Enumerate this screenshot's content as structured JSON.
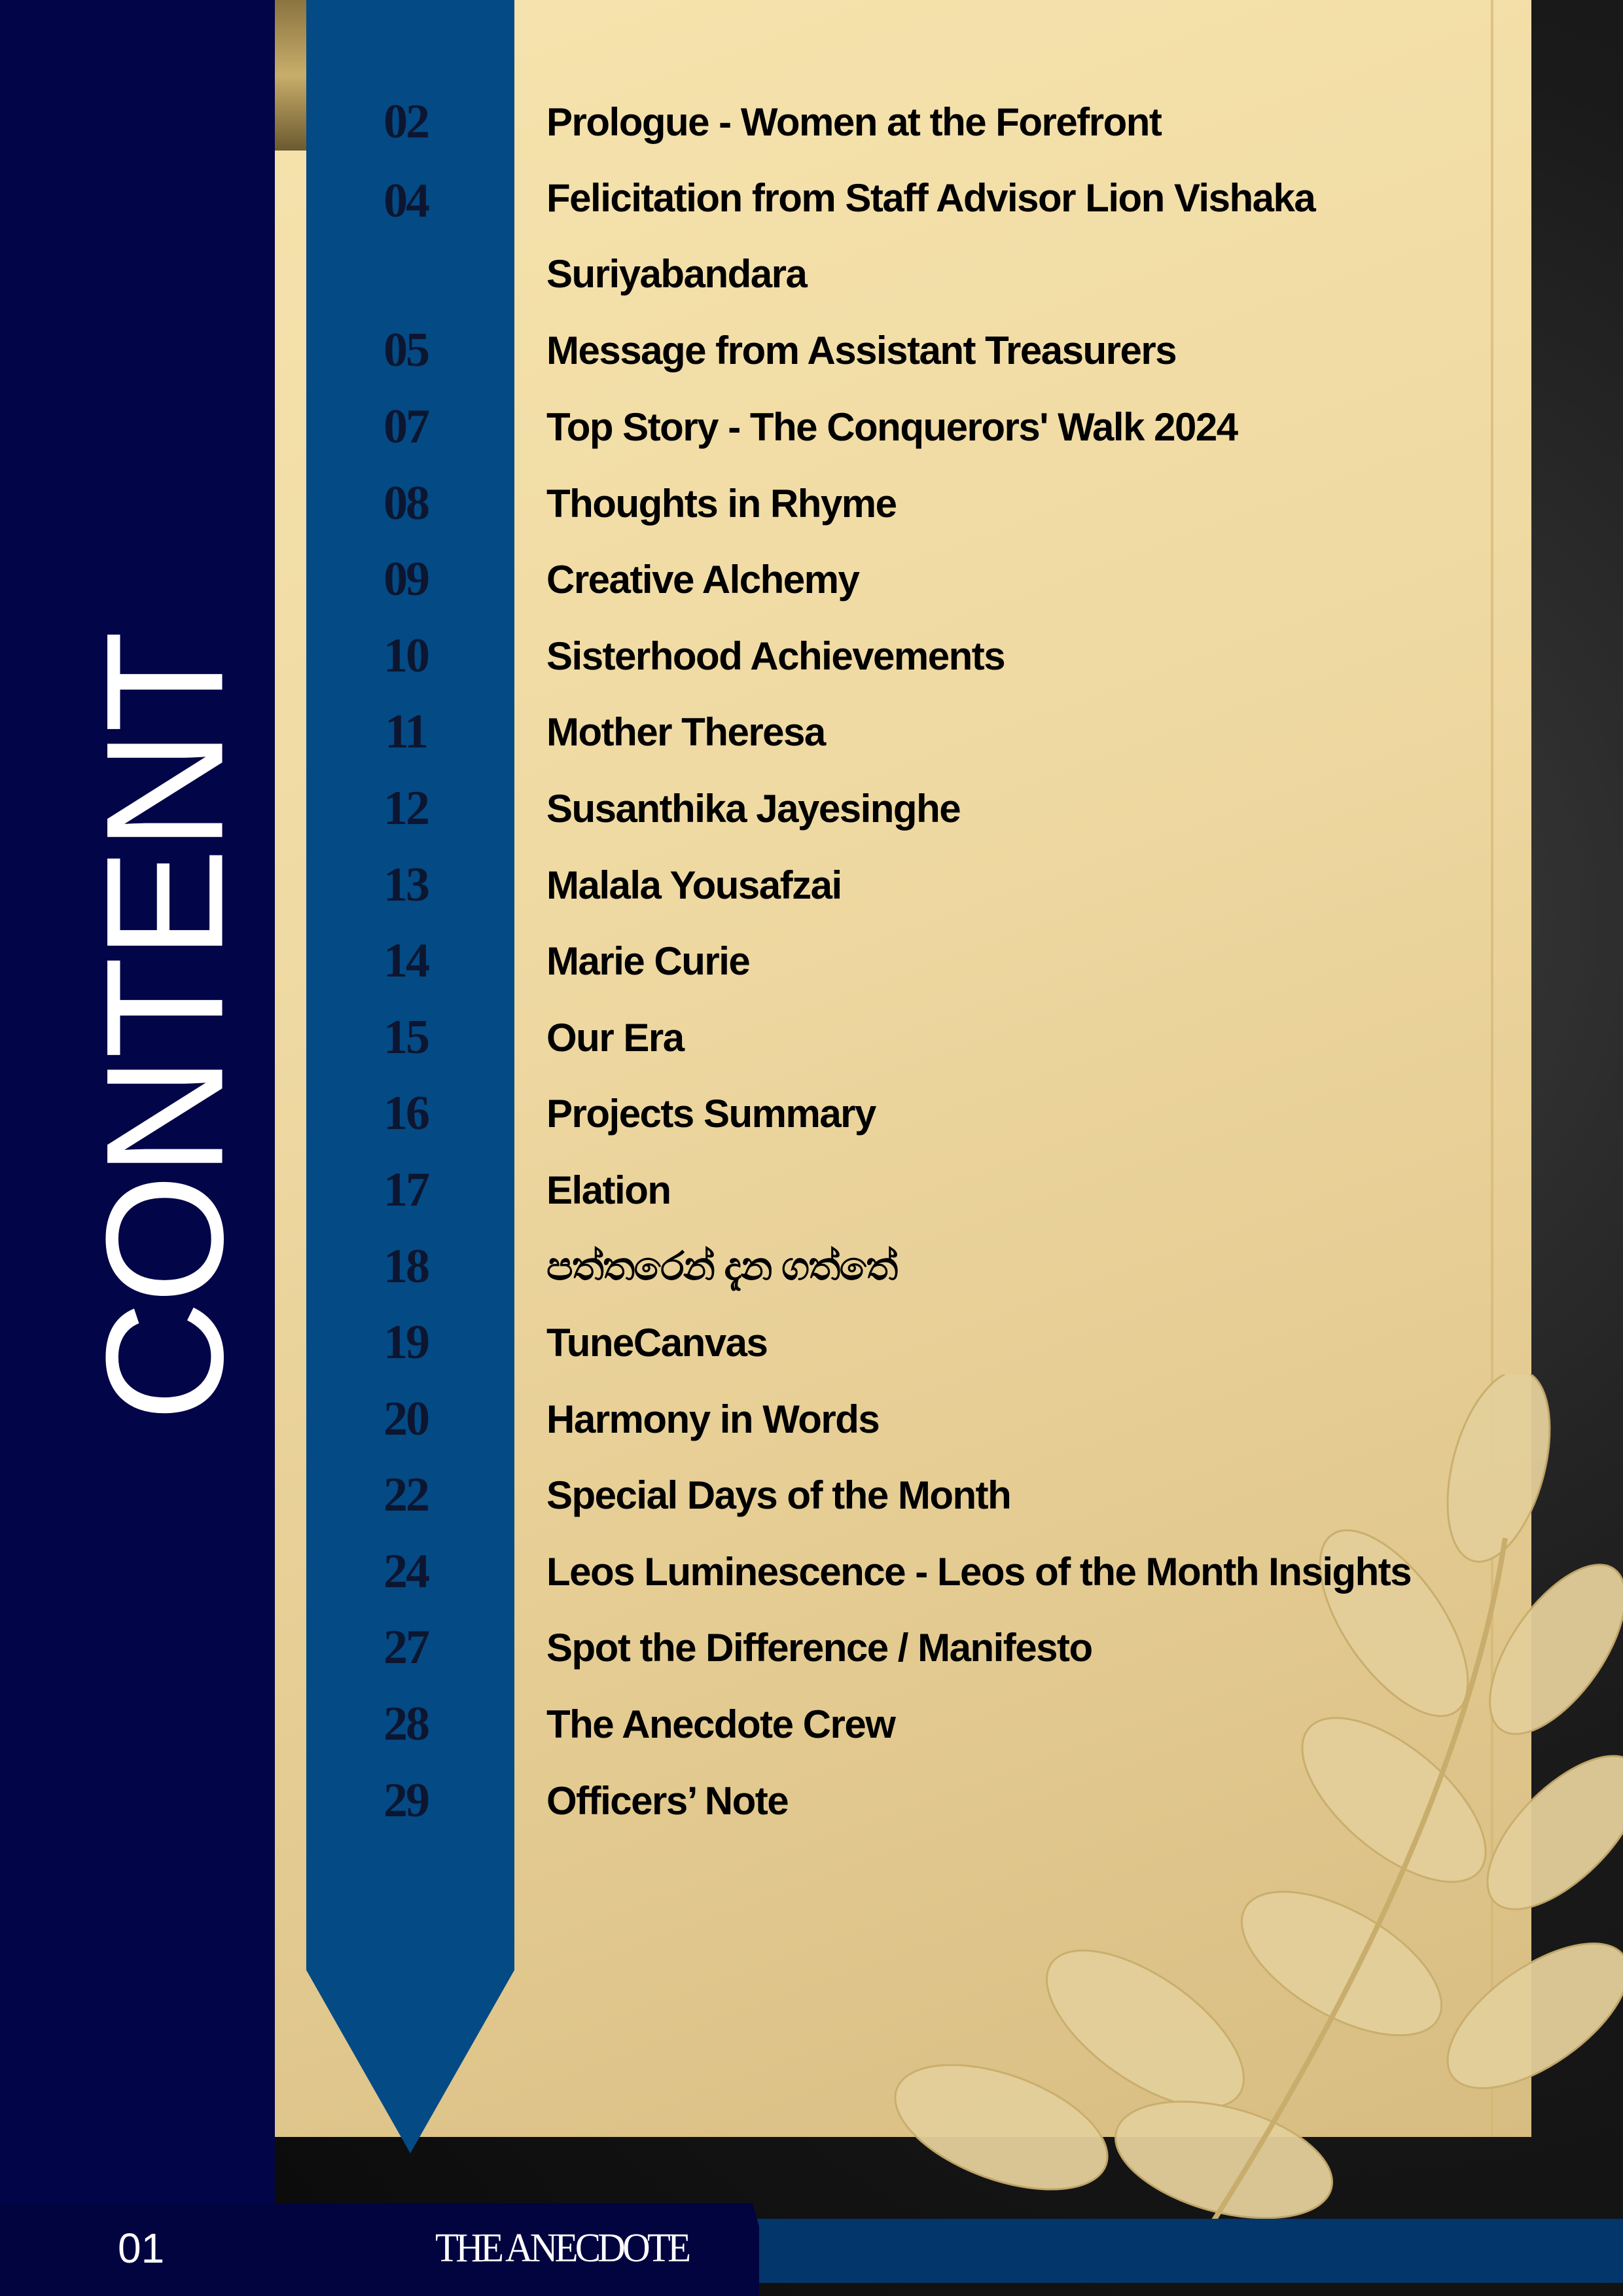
{
  "heading": "CONTENT",
  "colors": {
    "navy": "#020548",
    "ribbon": "#044a85",
    "panel": "#f3dfa8",
    "footer_blue": "#03366b"
  },
  "toc": [
    {
      "page": "02",
      "title": "Prologue - Women at the Forefront"
    },
    {
      "page": "04",
      "title": "Felicitation from Staff Advisor Lion Vishaka Suriyabandara"
    },
    {
      "page": "05",
      "title": "Message from Assistant Treasurers"
    },
    {
      "page": "07",
      "title": "Top Story - The Conquerors' Walk 2024"
    },
    {
      "page": "08",
      "title": "Thoughts in Rhyme"
    },
    {
      "page": "09",
      "title": "Creative Alchemy"
    },
    {
      "page": "10",
      "title": "Sisterhood Achievements"
    },
    {
      "page": "11",
      "title": "Mother Theresa"
    },
    {
      "page": "12",
      "title": "Susanthika Jayesinghe"
    },
    {
      "page": "13",
      "title": "Malala Yousafzai"
    },
    {
      "page": "14",
      "title": "Marie Curie"
    },
    {
      "page": "15",
      "title": "Our Era"
    },
    {
      "page": "16",
      "title": "Projects Summary"
    },
    {
      "page": "17",
      "title": "Elation"
    },
    {
      "page": "18",
      "title": "පත්තරෙන් දැන ගත්තේ"
    },
    {
      "page": "19",
      "title": "TuneCanvas"
    },
    {
      "page": "20",
      "title": "Harmony in Words"
    },
    {
      "page": "22",
      "title": "Special Days of the Month"
    },
    {
      "page": "24",
      "title": "Leos Luminescence - Leos of the Month Insights"
    },
    {
      "page": "27",
      "title": "Spot the Difference / Manifesto"
    },
    {
      "page": "28",
      "title": "The Anecdote Crew"
    },
    {
      "page": "29",
      "title": "Officers’ Note"
    }
  ],
  "footer": {
    "page_number": "01",
    "magazine_name": "THE ANECDOTE"
  }
}
